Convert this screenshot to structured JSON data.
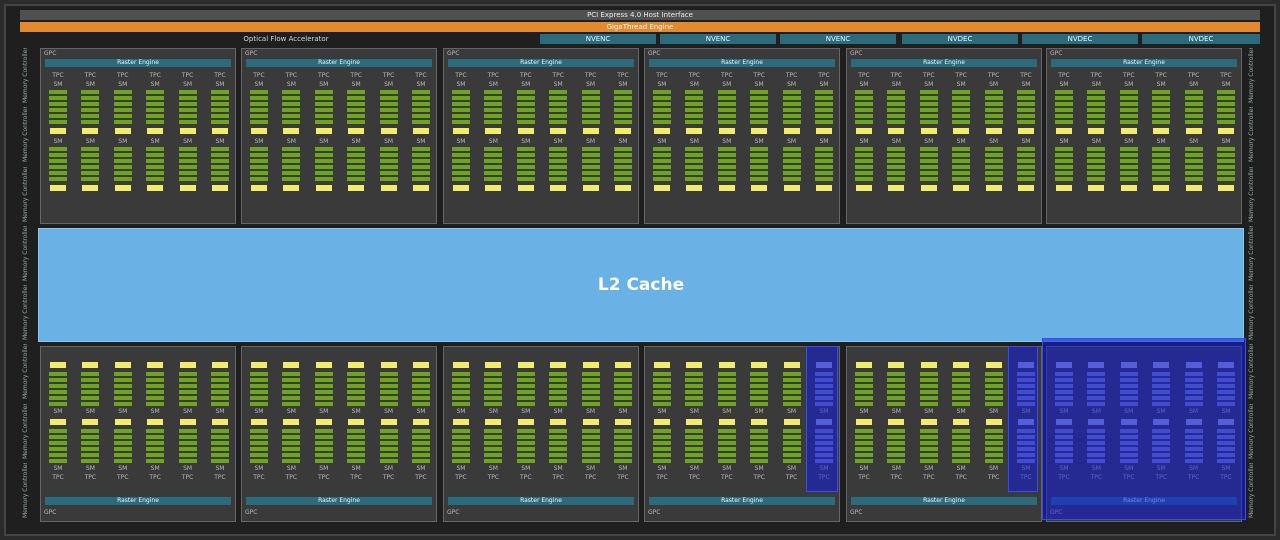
{
  "title_bars": {
    "pcie": "PCI Express 4.0 Host Interface",
    "gigathread": "GigaThread Engine"
  },
  "accelerators": {
    "ofa": "Optical Flow Accelerator",
    "units": [
      "NVENC",
      "NVENC",
      "NVENC",
      "NVDEC",
      "NVDEC",
      "NVDEC"
    ]
  },
  "memory_controller_label": "Memory Controller",
  "l2_cache": "L2 Cache",
  "gpc": {
    "label": "GPC",
    "raster": "Raster Engine",
    "tpc": "TPC",
    "sm": "SM"
  },
  "colors": {
    "cuda_cores": "#6ea51f",
    "texture_units": "#f1ec6a",
    "l2": "#6ab2e5",
    "gigathread": "#e58a2c",
    "disabled_highlight": "#1e32dc"
  }
}
